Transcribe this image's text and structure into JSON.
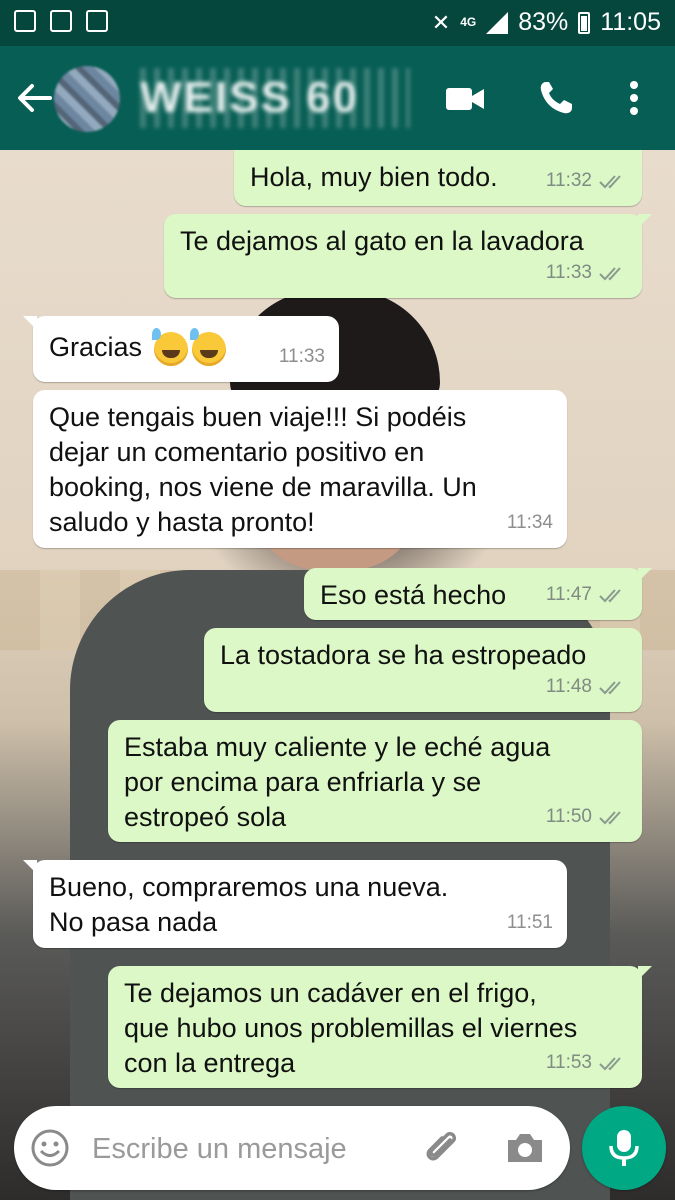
{
  "status_bar": {
    "network_label": "4G",
    "battery": "83%",
    "time": "11:05"
  },
  "header": {
    "contact_name": "WEISS 60",
    "icons": [
      "back-arrow-icon",
      "video-call-icon",
      "phone-icon",
      "more-vert-icon"
    ]
  },
  "messages": [
    {
      "dir": "out",
      "text": "Hola, muy bien todo.",
      "time": "11:32",
      "status": "read"
    },
    {
      "dir": "out",
      "text": "Te dejamos al gato en la lavadora",
      "time": "11:33",
      "status": "read"
    },
    {
      "dir": "in",
      "text": "Gracias",
      "time": "11:33",
      "emoji": "grinning-sweat-emoji x2"
    },
    {
      "dir": "in",
      "text": "Que tengais buen viaje!!! Si podéis\ndejar un comentario positivo en\nbooking, nos viene de maravilla. Un\nsaludo y hasta pronto!",
      "time": "11:34"
    },
    {
      "dir": "out",
      "text": "Eso está hecho",
      "time": "11:47",
      "status": "read"
    },
    {
      "dir": "out",
      "text": "La tostadora se ha estropeado",
      "time": "11:48",
      "status": "read"
    },
    {
      "dir": "out",
      "text": "Estaba muy caliente y le eché agua\npor encima para enfriarla y se\nestropeó sola",
      "time": "11:50",
      "status": "read"
    },
    {
      "dir": "in",
      "text": "Bueno, compraremos una nueva.\nNo pasa nada",
      "time": "11:51"
    },
    {
      "dir": "out",
      "text": "Te dejamos un cadáver en el frigo,\nque hubo unos problemillas el viernes\ncon la entrega",
      "time": "11:53",
      "status": "read"
    }
  ],
  "composer": {
    "placeholder": "Escribe un mensaje",
    "icons": [
      "emoji-icon",
      "attach-icon",
      "camera-icon",
      "mic-icon"
    ]
  },
  "colors": {
    "header": "#075e54",
    "status_bar": "#05473d",
    "outgoing_bubble": "#dcf8c6",
    "incoming_bubble": "#ffffff",
    "read_ticks": "#7f8b83",
    "mic_button": "#00a884"
  }
}
